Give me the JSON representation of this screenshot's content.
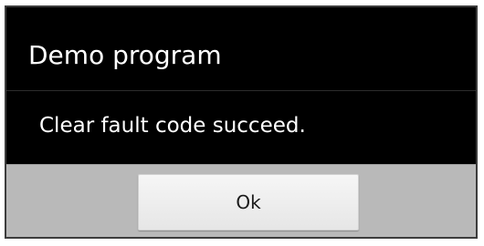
{
  "dialog": {
    "title": "Demo program",
    "message": "Clear fault code succeed.",
    "ok_label": "Ok"
  }
}
